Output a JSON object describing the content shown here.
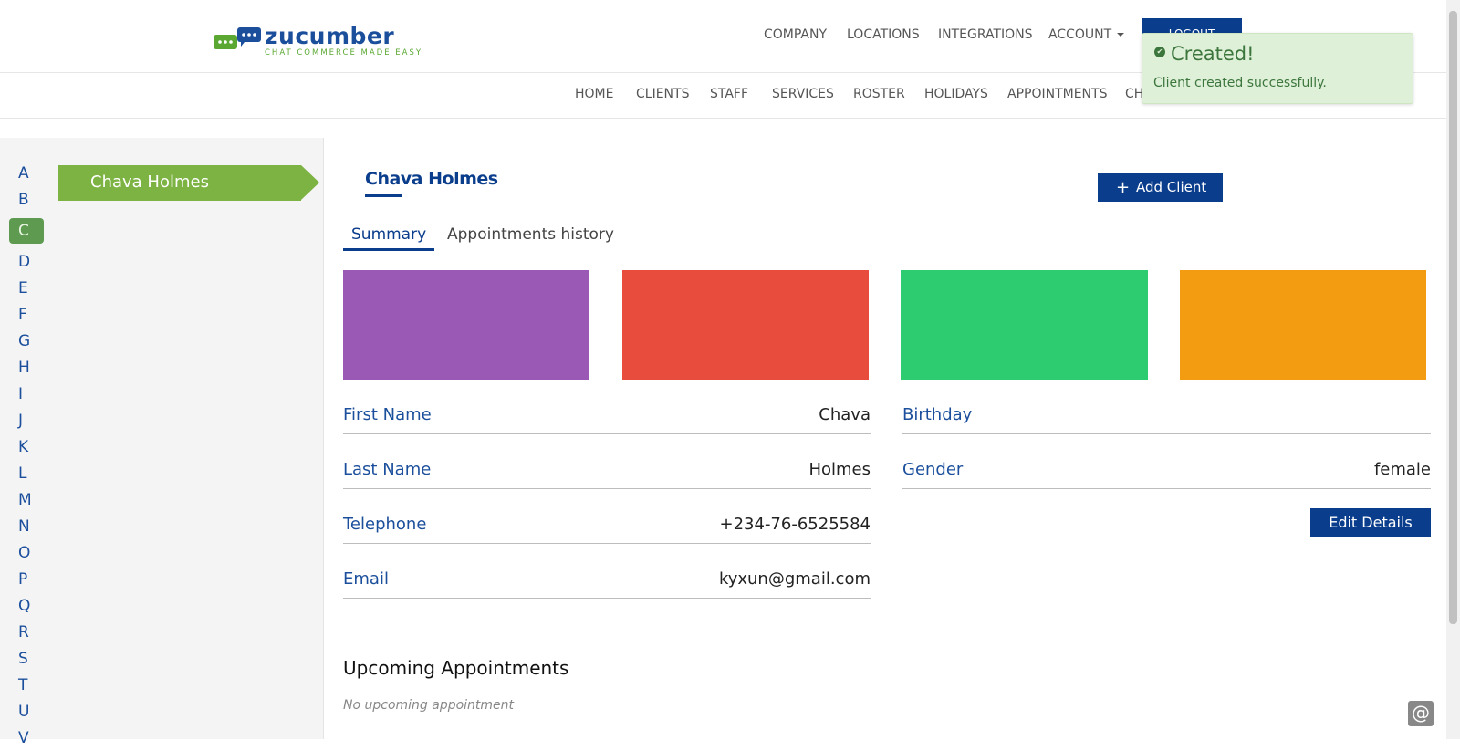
{
  "brand": {
    "name": "zucumber",
    "tagline": "CHAT COMMERCE MADE EASY"
  },
  "top_nav": {
    "company": "COMPANY",
    "locations": "LOCATIONS",
    "integrations": "INTEGRATIONS",
    "account": "ACCOUNT",
    "logout": "LOGOUT"
  },
  "sub_nav": [
    "HOME",
    "CLIENTS",
    "STAFF",
    "SERVICES",
    "ROSTER",
    "HOLIDAYS",
    "APPOINTMENTS",
    "CH"
  ],
  "toast": {
    "title": "Created!",
    "message": "Client created successfully.",
    "color": "#dff0d8"
  },
  "alphabet": [
    "A",
    "B",
    "C",
    "D",
    "E",
    "F",
    "G",
    "H",
    "I",
    "J",
    "K",
    "L",
    "M",
    "N",
    "O",
    "P",
    "Q",
    "R",
    "S",
    "T",
    "U",
    "V"
  ],
  "active_letter": "C",
  "client_list": {
    "selected": "Chava Holmes"
  },
  "client": {
    "title": "Chava Holmes",
    "add_client_label": "Add Client",
    "tabs": {
      "summary": "Summary",
      "history": "Appointments history"
    },
    "tile_colors": [
      "#9b59b6",
      "#e74c3c",
      "#2ecc71",
      "#f39c12"
    ],
    "fields_left": [
      {
        "label": "First Name",
        "value": "Chava"
      },
      {
        "label": "Last Name",
        "value": "Holmes"
      },
      {
        "label": "Telephone",
        "value": "+234-76-6525584"
      },
      {
        "label": "Email",
        "value": "kyxun@gmail.com"
      }
    ],
    "fields_right": [
      {
        "label": "Birthday",
        "value": ""
      },
      {
        "label": "Gender",
        "value": "female"
      }
    ],
    "edit_label": "Edit Details",
    "upcoming_title": "Upcoming Appointments",
    "no_upcoming": "No upcoming appointment"
  },
  "accent_color": "#0a3d8c",
  "chat_widget_icon": "at-icon"
}
